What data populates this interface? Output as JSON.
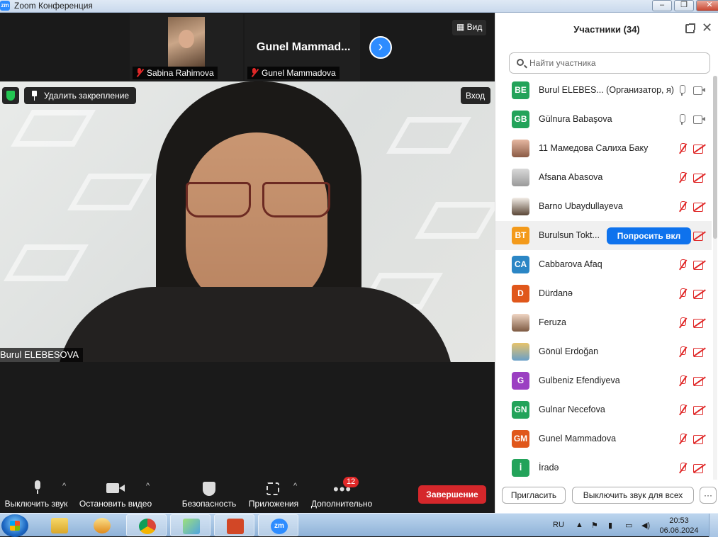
{
  "window": {
    "title": "Zoom Конференция",
    "app_icon": "zm"
  },
  "thumbnails": [
    {
      "name": "Sabina Rahimova",
      "muted": true
    },
    {
      "name": "Gunel Mammadova",
      "display_name": "Gunel  Mammad...",
      "muted": true
    }
  ],
  "view_button": "Вид",
  "main_video": {
    "unpin_label": "Удалить закрепление",
    "enter_label": "Вход",
    "speaker_name": "Burul ELEBESOVA"
  },
  "toolbar": {
    "mute": "Выключить звук",
    "video": "Остановить видео",
    "security": "Безопасность",
    "apps": "Приложения",
    "more": "Дополнительно",
    "more_badge": "12",
    "end": "Завершение"
  },
  "participants_panel": {
    "title": "Участники (34)",
    "search_placeholder": "Найти участника",
    "ask_unmute": "Попросить вкл",
    "invite": "Пригласить",
    "mute_all": "Выключить звук для всех",
    "more": "···",
    "items": [
      {
        "initials": "BE",
        "name": "Burul ELEBES...   (Организатор, я)",
        "color": "#23a35a",
        "mic": "on",
        "cam": "on"
      },
      {
        "initials": "GB",
        "name": "Gülnura Babaşova",
        "color": "#23a35a",
        "mic": "on",
        "cam": "on"
      },
      {
        "initials": "",
        "name": "11 Мамедова Салиха Баку",
        "photo": true,
        "mic": "off",
        "cam": "off"
      },
      {
        "initials": "",
        "name": "Afsana Abasova",
        "photo": true,
        "mic": "off",
        "cam": "off"
      },
      {
        "initials": "",
        "name": "Barno Ubaydullayeva",
        "photo": true,
        "mic": "off",
        "cam": "off"
      },
      {
        "initials": "BT",
        "name": "Burulsun Tokt...",
        "color": "#f39a1b",
        "mic": "off",
        "cam": "off",
        "highlight": true
      },
      {
        "initials": "CA",
        "name": "Cabbarova Afaq",
        "color": "#2b86c5",
        "mic": "off",
        "cam": "off"
      },
      {
        "initials": "D",
        "name": "Dürdanə",
        "color": "#e0571b",
        "mic": "off",
        "cam": "off"
      },
      {
        "initials": "",
        "name": "Feruza",
        "photo": true,
        "mic": "off",
        "cam": "off"
      },
      {
        "initials": "",
        "name": "Gönül Erdoğan",
        "photo": true,
        "mic": "off",
        "cam": "off"
      },
      {
        "initials": "G",
        "name": "Gulbeniz Efendiyeva",
        "color": "#9b3fc2",
        "mic": "off",
        "cam": "off"
      },
      {
        "initials": "GN",
        "name": "Gulnar Necefova",
        "color": "#23a35a",
        "mic": "off",
        "cam": "off"
      },
      {
        "initials": "GM",
        "name": "Gunel Mammadova",
        "color": "#e0571b",
        "mic": "off",
        "cam": "off"
      },
      {
        "initials": "İ",
        "name": "İradə",
        "color": "#23a35a",
        "mic": "off",
        "cam": "off"
      }
    ]
  },
  "taskbar": {
    "lang": "RU",
    "time": "20:53",
    "date": "06.06.2024",
    "apps": [
      "start-button",
      "file-explorer",
      "media-player",
      "chrome",
      "photos",
      "powerpoint",
      "zoom"
    ]
  },
  "colors": {
    "accent": "#2d8cff",
    "end": "#d5272b",
    "muted_red": "#e02828"
  }
}
